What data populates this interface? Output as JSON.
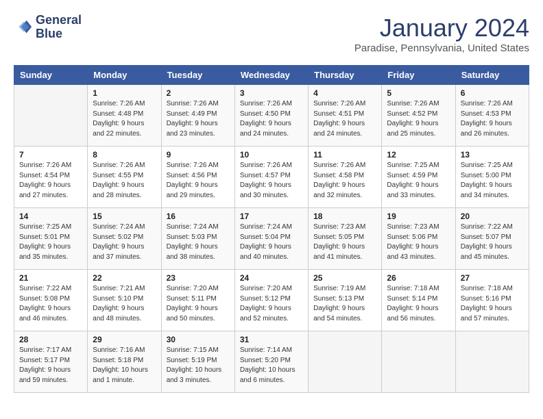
{
  "header": {
    "logo_line1": "General",
    "logo_line2": "Blue",
    "month_year": "January 2024",
    "location": "Paradise, Pennsylvania, United States"
  },
  "weekdays": [
    "Sunday",
    "Monday",
    "Tuesday",
    "Wednesday",
    "Thursday",
    "Friday",
    "Saturday"
  ],
  "weeks": [
    [
      {
        "day": "",
        "lines": []
      },
      {
        "day": "1",
        "lines": [
          "Sunrise: 7:26 AM",
          "Sunset: 4:48 PM",
          "Daylight: 9 hours",
          "and 22 minutes."
        ]
      },
      {
        "day": "2",
        "lines": [
          "Sunrise: 7:26 AM",
          "Sunset: 4:49 PM",
          "Daylight: 9 hours",
          "and 23 minutes."
        ]
      },
      {
        "day": "3",
        "lines": [
          "Sunrise: 7:26 AM",
          "Sunset: 4:50 PM",
          "Daylight: 9 hours",
          "and 24 minutes."
        ]
      },
      {
        "day": "4",
        "lines": [
          "Sunrise: 7:26 AM",
          "Sunset: 4:51 PM",
          "Daylight: 9 hours",
          "and 24 minutes."
        ]
      },
      {
        "day": "5",
        "lines": [
          "Sunrise: 7:26 AM",
          "Sunset: 4:52 PM",
          "Daylight: 9 hours",
          "and 25 minutes."
        ]
      },
      {
        "day": "6",
        "lines": [
          "Sunrise: 7:26 AM",
          "Sunset: 4:53 PM",
          "Daylight: 9 hours",
          "and 26 minutes."
        ]
      }
    ],
    [
      {
        "day": "7",
        "lines": [
          "Sunrise: 7:26 AM",
          "Sunset: 4:54 PM",
          "Daylight: 9 hours",
          "and 27 minutes."
        ]
      },
      {
        "day": "8",
        "lines": [
          "Sunrise: 7:26 AM",
          "Sunset: 4:55 PM",
          "Daylight: 9 hours",
          "and 28 minutes."
        ]
      },
      {
        "day": "9",
        "lines": [
          "Sunrise: 7:26 AM",
          "Sunset: 4:56 PM",
          "Daylight: 9 hours",
          "and 29 minutes."
        ]
      },
      {
        "day": "10",
        "lines": [
          "Sunrise: 7:26 AM",
          "Sunset: 4:57 PM",
          "Daylight: 9 hours",
          "and 30 minutes."
        ]
      },
      {
        "day": "11",
        "lines": [
          "Sunrise: 7:26 AM",
          "Sunset: 4:58 PM",
          "Daylight: 9 hours",
          "and 32 minutes."
        ]
      },
      {
        "day": "12",
        "lines": [
          "Sunrise: 7:25 AM",
          "Sunset: 4:59 PM",
          "Daylight: 9 hours",
          "and 33 minutes."
        ]
      },
      {
        "day": "13",
        "lines": [
          "Sunrise: 7:25 AM",
          "Sunset: 5:00 PM",
          "Daylight: 9 hours",
          "and 34 minutes."
        ]
      }
    ],
    [
      {
        "day": "14",
        "lines": [
          "Sunrise: 7:25 AM",
          "Sunset: 5:01 PM",
          "Daylight: 9 hours",
          "and 35 minutes."
        ]
      },
      {
        "day": "15",
        "lines": [
          "Sunrise: 7:24 AM",
          "Sunset: 5:02 PM",
          "Daylight: 9 hours",
          "and 37 minutes."
        ]
      },
      {
        "day": "16",
        "lines": [
          "Sunrise: 7:24 AM",
          "Sunset: 5:03 PM",
          "Daylight: 9 hours",
          "and 38 minutes."
        ]
      },
      {
        "day": "17",
        "lines": [
          "Sunrise: 7:24 AM",
          "Sunset: 5:04 PM",
          "Daylight: 9 hours",
          "and 40 minutes."
        ]
      },
      {
        "day": "18",
        "lines": [
          "Sunrise: 7:23 AM",
          "Sunset: 5:05 PM",
          "Daylight: 9 hours",
          "and 41 minutes."
        ]
      },
      {
        "day": "19",
        "lines": [
          "Sunrise: 7:23 AM",
          "Sunset: 5:06 PM",
          "Daylight: 9 hours",
          "and 43 minutes."
        ]
      },
      {
        "day": "20",
        "lines": [
          "Sunrise: 7:22 AM",
          "Sunset: 5:07 PM",
          "Daylight: 9 hours",
          "and 45 minutes."
        ]
      }
    ],
    [
      {
        "day": "21",
        "lines": [
          "Sunrise: 7:22 AM",
          "Sunset: 5:08 PM",
          "Daylight: 9 hours",
          "and 46 minutes."
        ]
      },
      {
        "day": "22",
        "lines": [
          "Sunrise: 7:21 AM",
          "Sunset: 5:10 PM",
          "Daylight: 9 hours",
          "and 48 minutes."
        ]
      },
      {
        "day": "23",
        "lines": [
          "Sunrise: 7:20 AM",
          "Sunset: 5:11 PM",
          "Daylight: 9 hours",
          "and 50 minutes."
        ]
      },
      {
        "day": "24",
        "lines": [
          "Sunrise: 7:20 AM",
          "Sunset: 5:12 PM",
          "Daylight: 9 hours",
          "and 52 minutes."
        ]
      },
      {
        "day": "25",
        "lines": [
          "Sunrise: 7:19 AM",
          "Sunset: 5:13 PM",
          "Daylight: 9 hours",
          "and 54 minutes."
        ]
      },
      {
        "day": "26",
        "lines": [
          "Sunrise: 7:18 AM",
          "Sunset: 5:14 PM",
          "Daylight: 9 hours",
          "and 56 minutes."
        ]
      },
      {
        "day": "27",
        "lines": [
          "Sunrise: 7:18 AM",
          "Sunset: 5:16 PM",
          "Daylight: 9 hours",
          "and 57 minutes."
        ]
      }
    ],
    [
      {
        "day": "28",
        "lines": [
          "Sunrise: 7:17 AM",
          "Sunset: 5:17 PM",
          "Daylight: 9 hours",
          "and 59 minutes."
        ]
      },
      {
        "day": "29",
        "lines": [
          "Sunrise: 7:16 AM",
          "Sunset: 5:18 PM",
          "Daylight: 10 hours",
          "and 1 minute."
        ]
      },
      {
        "day": "30",
        "lines": [
          "Sunrise: 7:15 AM",
          "Sunset: 5:19 PM",
          "Daylight: 10 hours",
          "and 3 minutes."
        ]
      },
      {
        "day": "31",
        "lines": [
          "Sunrise: 7:14 AM",
          "Sunset: 5:20 PM",
          "Daylight: 10 hours",
          "and 6 minutes."
        ]
      },
      {
        "day": "",
        "lines": []
      },
      {
        "day": "",
        "lines": []
      },
      {
        "day": "",
        "lines": []
      }
    ]
  ]
}
